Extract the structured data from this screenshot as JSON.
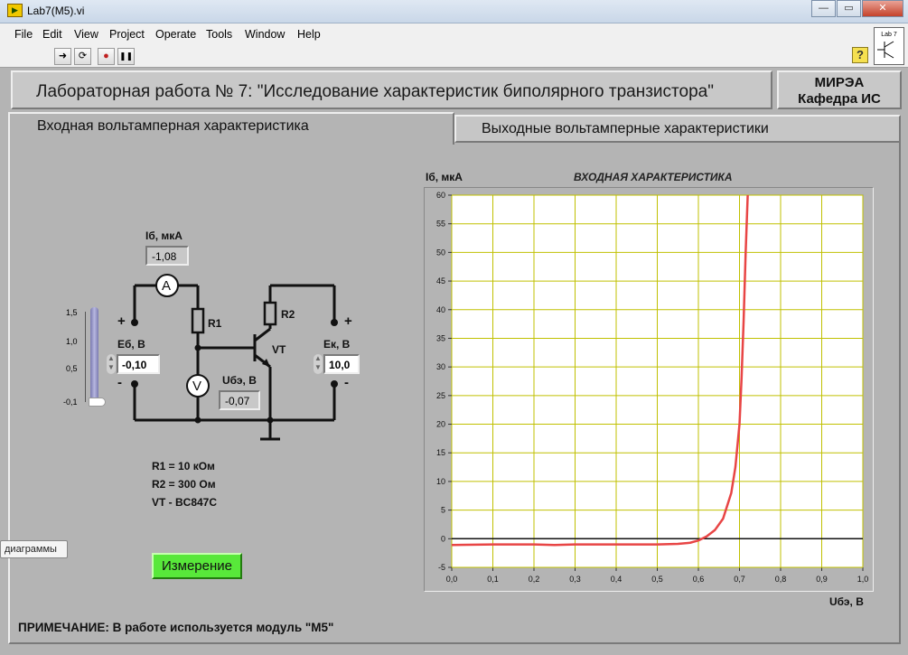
{
  "window": {
    "title": "Lab7(M5).vi",
    "controls": [
      "—",
      "▭",
      "✕"
    ]
  },
  "menu": [
    "File",
    "Edit",
    "View",
    "Project",
    "Operate",
    "Tools",
    "Window",
    "Help"
  ],
  "toolbar": {
    "run": "➜",
    "run_cont": "⟳",
    "abort": "●",
    "pause": "❚❚",
    "help": "?"
  },
  "connector": {
    "label": "Lab 7"
  },
  "header": {
    "title": "Лабораторная работа № 7: \"Исследование характеристик биполярного транзистора\"",
    "org_line1": "МИРЭА",
    "org_line2": "Кафедра ИС"
  },
  "tabs": [
    {
      "label": "Входная вольтамперная характеристика",
      "active": true
    },
    {
      "label": "Выходные вольтамперные характеристики",
      "active": false
    }
  ],
  "circuit": {
    "ib_label": "Iб, мкА",
    "ib_value": "-1,08",
    "eb_label": "Eб, В",
    "eb_value": "-0,10",
    "ek_label": "Eк, В",
    "ek_value": "10,0",
    "ube_label": "Uбэ, В",
    "ube_value": "-0,07",
    "r1": "R1",
    "r2": "R2",
    "vt": "VT",
    "ammeter": "A",
    "voltmeter": "V",
    "plus": "+",
    "minus": "-"
  },
  "slider": {
    "ticks": [
      "1,5",
      "1,0",
      "0,5",
      "-0,1"
    ],
    "value": -0.1,
    "min": -0.1,
    "max": 1.5
  },
  "specs": {
    "r1": "R1 = 10 кОм",
    "r2": "R2 = 300 Ом",
    "vt": "VT - BC847C"
  },
  "measure_button": "Измерение",
  "tooltip": "диаграммы",
  "note": "ПРИМЕЧАНИЕ: В работе используется модуль \"М5\"",
  "colors": {
    "curve": "#e84545",
    "grid": "#c0c000",
    "button": "#58e83a"
  },
  "chart_data": {
    "type": "line",
    "title": "ВХОДНАЯ ХАРАКТЕРИСТИКА",
    "xlabel": "Uбэ, В",
    "ylabel": "Iб, мкА",
    "xlim": [
      0.0,
      1.0
    ],
    "ylim": [
      -5,
      60
    ],
    "x_ticks": [
      "0,0",
      "0,1",
      "0,2",
      "0,3",
      "0,4",
      "0,5",
      "0,6",
      "0,7",
      "0,8",
      "0,9",
      "1,0"
    ],
    "y_ticks": [
      "-5",
      "0",
      "5",
      "10",
      "15",
      "20",
      "25",
      "30",
      "35",
      "40",
      "45",
      "50",
      "55",
      "60"
    ],
    "grid": true,
    "series": [
      {
        "x": [
          0.0,
          0.1,
          0.2,
          0.25,
          0.3,
          0.4,
          0.5,
          0.55,
          0.58,
          0.6,
          0.62,
          0.64,
          0.66,
          0.68,
          0.69,
          0.7,
          0.705,
          0.71,
          0.715,
          0.72
        ],
        "y": [
          -1.1,
          -1.0,
          -1.0,
          -1.1,
          -1.0,
          -1.0,
          -1.0,
          -0.9,
          -0.7,
          -0.3,
          0.4,
          1.5,
          3.5,
          8.0,
          12.5,
          20.0,
          28.0,
          38.0,
          50.0,
          60.0
        ]
      }
    ]
  }
}
